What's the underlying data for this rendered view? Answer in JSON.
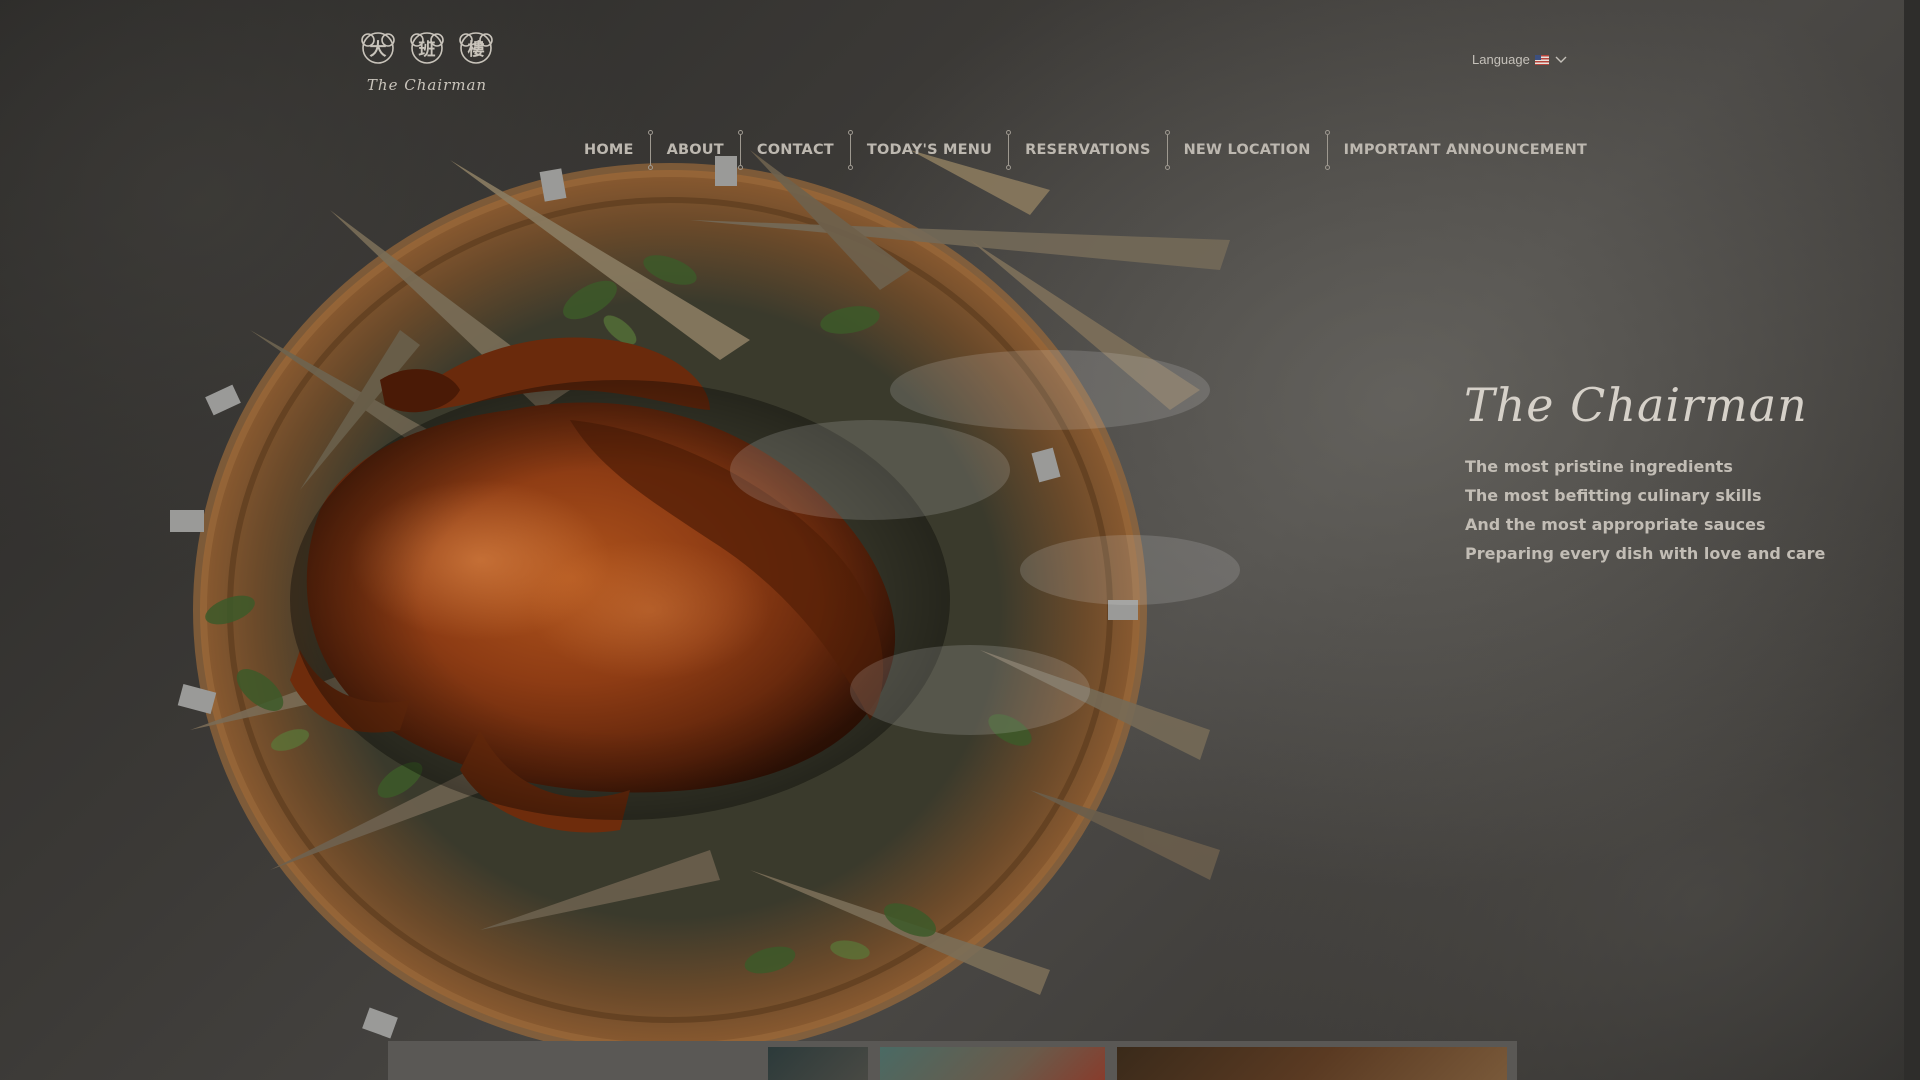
{
  "header": {
    "logo_characters": [
      "大",
      "班",
      "樓"
    ],
    "logo_caption": "The Chairman",
    "language_label": "Language"
  },
  "nav": {
    "items": [
      {
        "label": "HOME"
      },
      {
        "label": "ABOUT"
      },
      {
        "label": "CONTACT"
      },
      {
        "label": "TODAY'S MENU"
      },
      {
        "label": "RESERVATIONS"
      },
      {
        "label": "NEW LOCATION"
      },
      {
        "label": "IMPORTANT ANNOUNCEMENT"
      }
    ]
  },
  "hero": {
    "title": "The Chairman",
    "lines": [
      "The most pristine ingredients",
      "The most befitting culinary skills",
      "And the most appropriate sauces",
      "Preparing every dish with love and care"
    ]
  },
  "colors": {
    "background": "#3c3a37",
    "text": "#c2bdb5",
    "accent_duck": "#8a3b12"
  }
}
